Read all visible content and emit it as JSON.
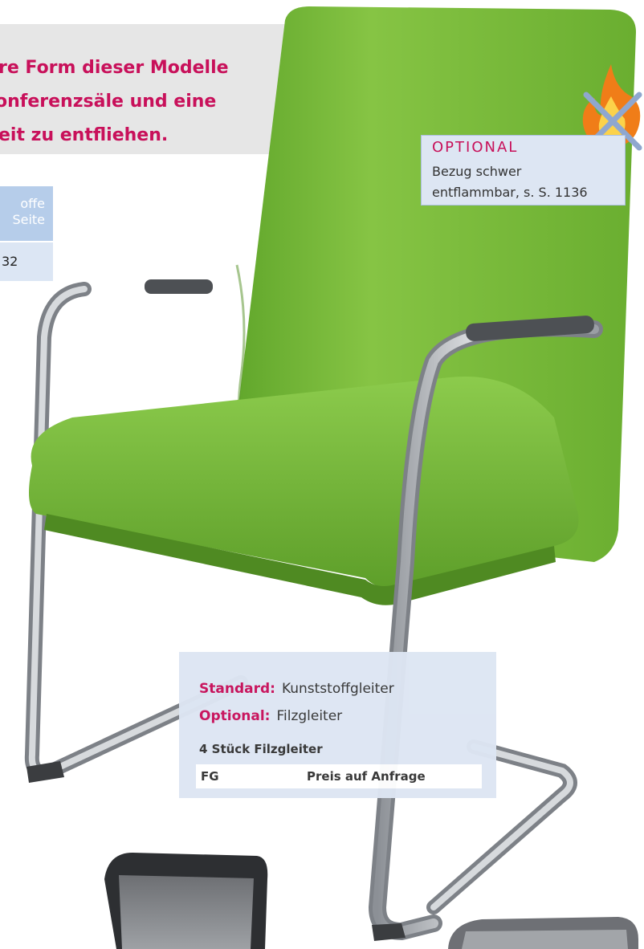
{
  "intro": {
    "line1": "re Form dieser Modelle",
    "line2": "onferenzsäle und eine",
    "line3": "eit zu entfliehen."
  },
  "fabric_table": {
    "header_line1": "offe",
    "header_line2": "Seite",
    "value": "32"
  },
  "optional_box": {
    "title": "OPTIONAL",
    "line1": "Bezug schwer",
    "line2": "entflammbar, s. S. 1136",
    "icon": "no-fire-icon"
  },
  "glides": {
    "standard_label": "Standard:",
    "standard_value": "Kunststoffgleiter",
    "optional_label": "Optional:",
    "optional_value": "Filzgleiter",
    "subheading": "4 Stück Filzgleiter",
    "code": "FG",
    "price": "Preis auf Anfrage"
  },
  "colors": {
    "accent": "#c8105a",
    "panel_blue": "#dde6f3",
    "seat_green": "#7cbf3a"
  }
}
